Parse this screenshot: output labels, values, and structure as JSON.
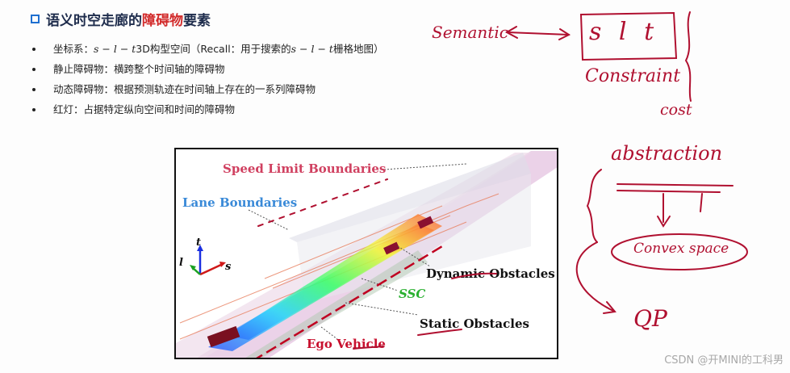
{
  "title": {
    "prefix": "语义时空走廊的",
    "highlight": "障碍物",
    "suffix": "要素"
  },
  "bullets": [
    {
      "label": "坐标系：",
      "math1": "s − l − t",
      "text1": " 3D构型空间（Recall：用于搜索的",
      "math2": "s − l − t",
      "text2": "栅格地图）"
    },
    {
      "label": "静止障碍物：",
      "text1": "横跨整个时间轴的障碍物"
    },
    {
      "label": "动态障碍物：",
      "text1": "根据预测轨迹在时间轴上存在的一系列障碍物"
    },
    {
      "label": "红灯：",
      "text1": "占据特定纵向空间和时间的障碍物"
    }
  ],
  "figure": {
    "speed_limit": "Speed Limit Boundaries",
    "lane": "Lane Boundaries",
    "dynamic": "Dynamic Obstacles",
    "ssc": "SSC",
    "static": "Static Obstacles",
    "ego": "Ego Vehicle",
    "axis_t": "t",
    "axis_l": "l",
    "axis_s": "s"
  },
  "annotations": {
    "semantic": "Semantic",
    "slt": "s l t",
    "constraint": "Constraint",
    "cost": "cost",
    "abstraction": "abstraction",
    "convex": "Convex space",
    "qp": "QP"
  },
  "watermark": "CSDN @开MINI的工科男",
  "colors": {
    "accent": "#1e6fd0",
    "highlight": "#d22b2b",
    "ink": "#b01030"
  }
}
